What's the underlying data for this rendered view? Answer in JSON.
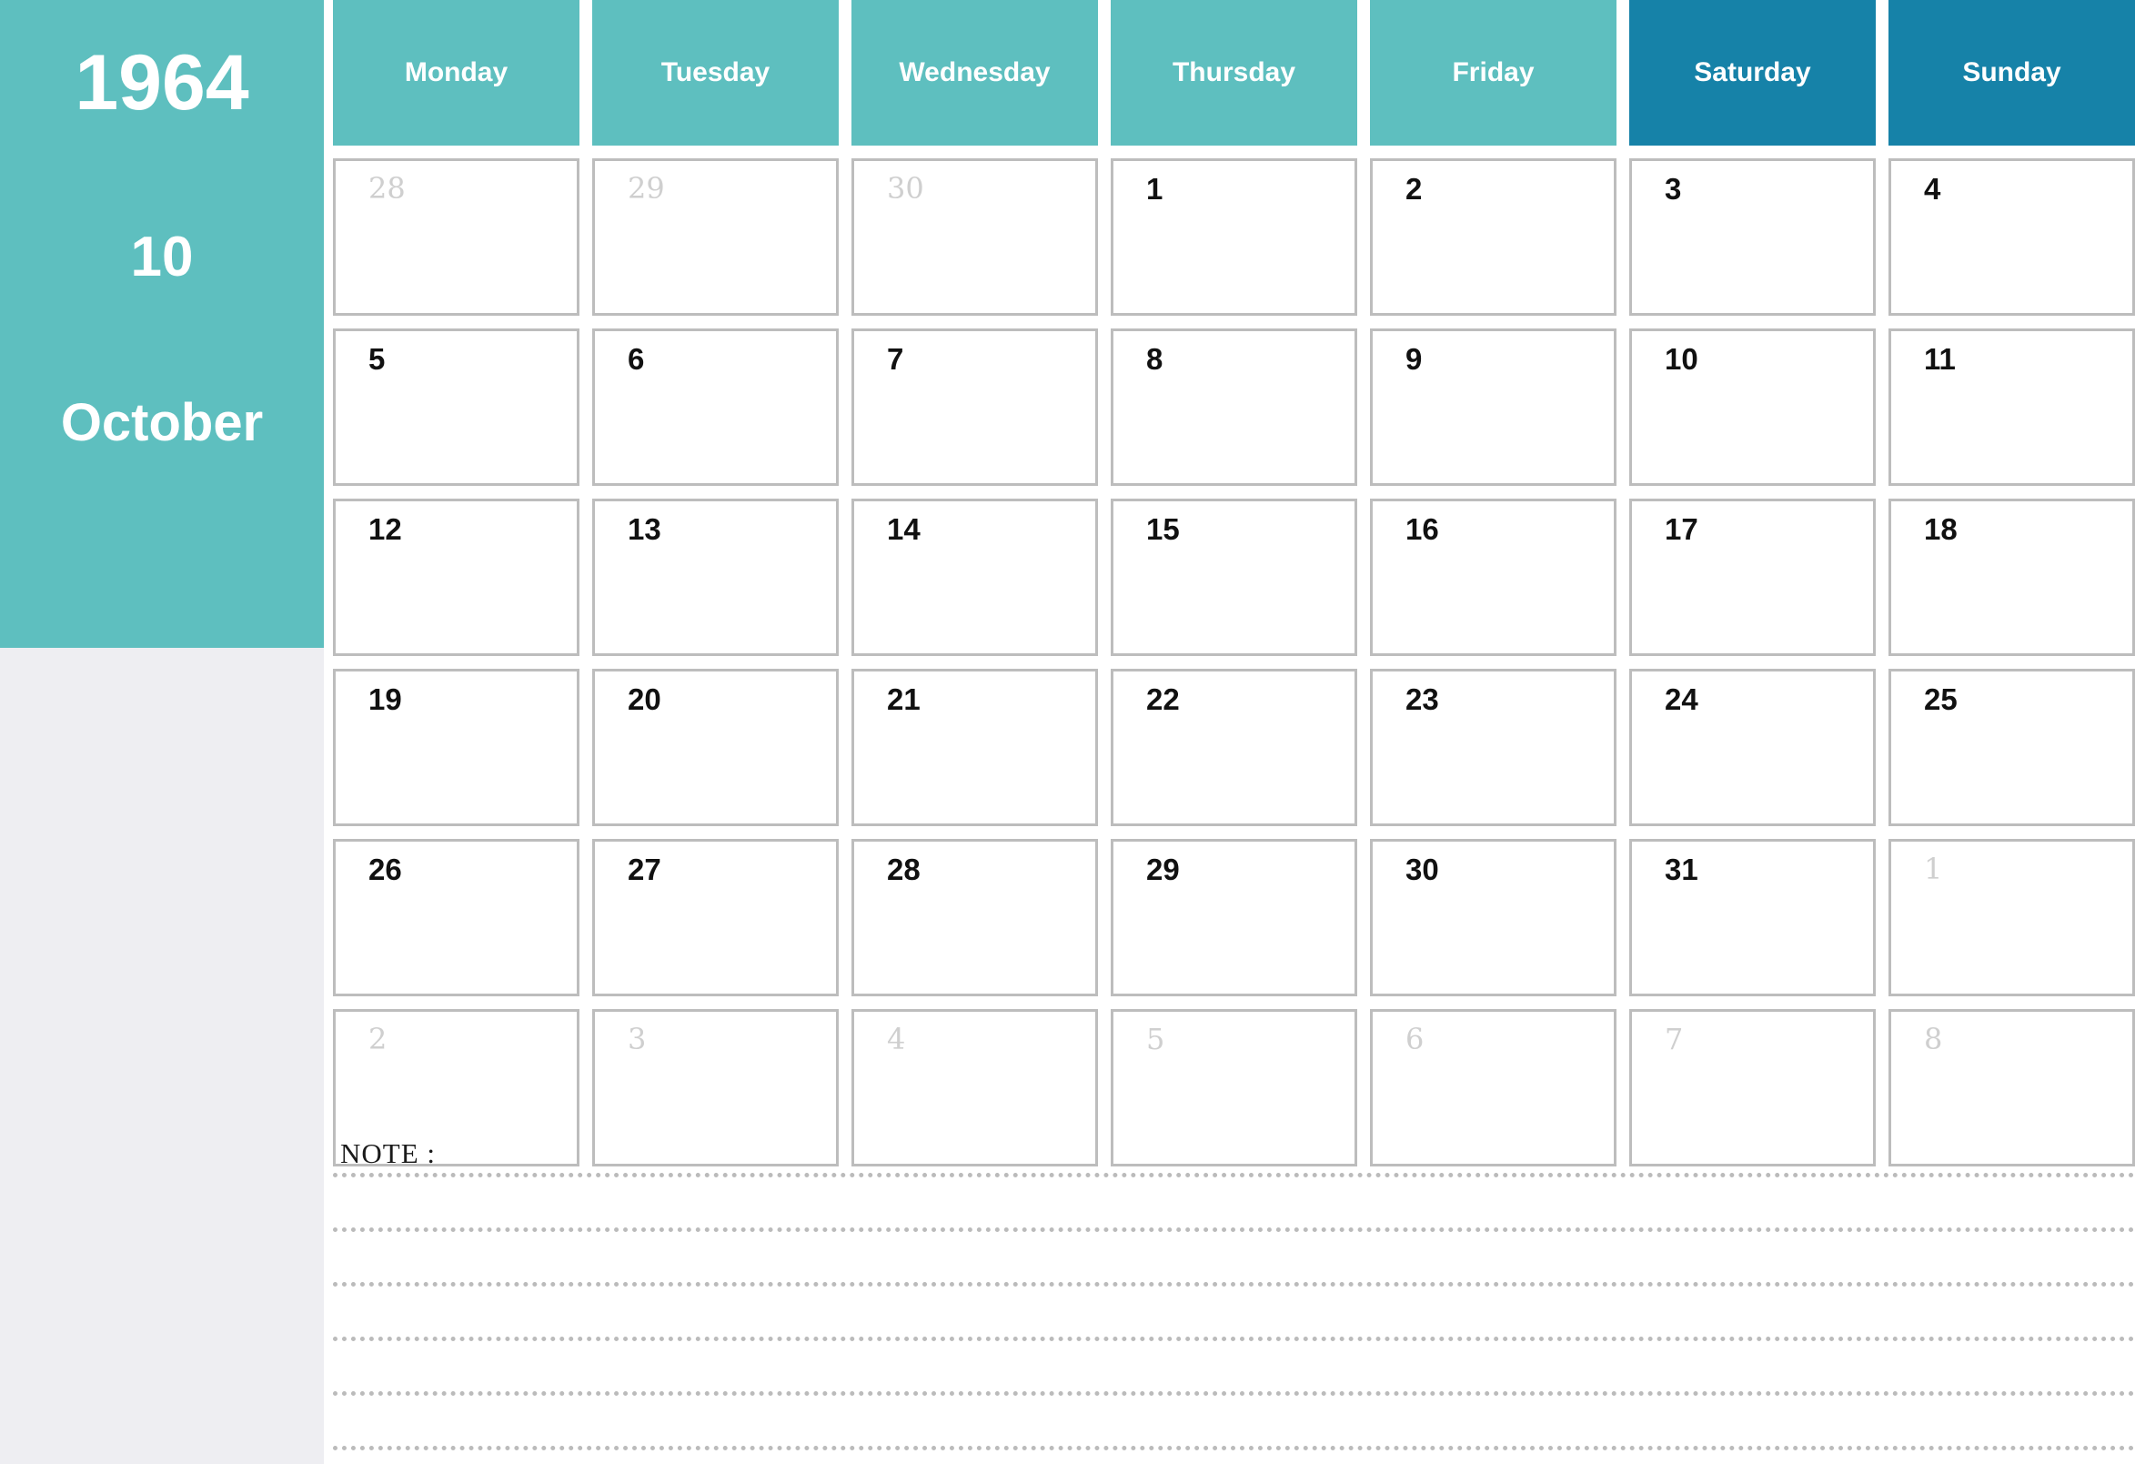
{
  "sidebar": {
    "year": "1964",
    "month_number": "10",
    "month_name": "October"
  },
  "colors": {
    "teal": "#5ebfbf",
    "weekend_blue": "#1682a8",
    "sidebar_gray": "#eeeef2",
    "cell_border": "#bdbdbd",
    "outside_day": "#cfcfcf",
    "inside_day": "#111111",
    "dotted_line": "#bbbbbb"
  },
  "weekdays": [
    {
      "label": "Monday",
      "weekend": false
    },
    {
      "label": "Tuesday",
      "weekend": false
    },
    {
      "label": "Wednesday",
      "weekend": false
    },
    {
      "label": "Thursday",
      "weekend": false
    },
    {
      "label": "Friday",
      "weekend": false
    },
    {
      "label": "Saturday",
      "weekend": true
    },
    {
      "label": "Sunday",
      "weekend": true
    }
  ],
  "weeks": [
    [
      {
        "day": "28",
        "outside": true
      },
      {
        "day": "29",
        "outside": true
      },
      {
        "day": "30",
        "outside": true
      },
      {
        "day": "1",
        "outside": false
      },
      {
        "day": "2",
        "outside": false
      },
      {
        "day": "3",
        "outside": false
      },
      {
        "day": "4",
        "outside": false
      }
    ],
    [
      {
        "day": "5",
        "outside": false
      },
      {
        "day": "6",
        "outside": false
      },
      {
        "day": "7",
        "outside": false
      },
      {
        "day": "8",
        "outside": false
      },
      {
        "day": "9",
        "outside": false
      },
      {
        "day": "10",
        "outside": false
      },
      {
        "day": "11",
        "outside": false
      }
    ],
    [
      {
        "day": "12",
        "outside": false
      },
      {
        "day": "13",
        "outside": false
      },
      {
        "day": "14",
        "outside": false
      },
      {
        "day": "15",
        "outside": false
      },
      {
        "day": "16",
        "outside": false
      },
      {
        "day": "17",
        "outside": false
      },
      {
        "day": "18",
        "outside": false
      }
    ],
    [
      {
        "day": "19",
        "outside": false
      },
      {
        "day": "20",
        "outside": false
      },
      {
        "day": "21",
        "outside": false
      },
      {
        "day": "22",
        "outside": false
      },
      {
        "day": "23",
        "outside": false
      },
      {
        "day": "24",
        "outside": false
      },
      {
        "day": "25",
        "outside": false
      }
    ],
    [
      {
        "day": "26",
        "outside": false
      },
      {
        "day": "27",
        "outside": false
      },
      {
        "day": "28",
        "outside": false
      },
      {
        "day": "29",
        "outside": false
      },
      {
        "day": "30",
        "outside": false
      },
      {
        "day": "31",
        "outside": false
      },
      {
        "day": "1",
        "outside": true
      }
    ],
    [
      {
        "day": "2",
        "outside": true
      },
      {
        "day": "3",
        "outside": true
      },
      {
        "day": "4",
        "outside": true
      },
      {
        "day": "5",
        "outside": true
      },
      {
        "day": "6",
        "outside": true
      },
      {
        "day": "7",
        "outside": true
      },
      {
        "day": "8",
        "outside": true
      }
    ]
  ],
  "notes": {
    "label": "NOTE :",
    "line_count": 6
  }
}
